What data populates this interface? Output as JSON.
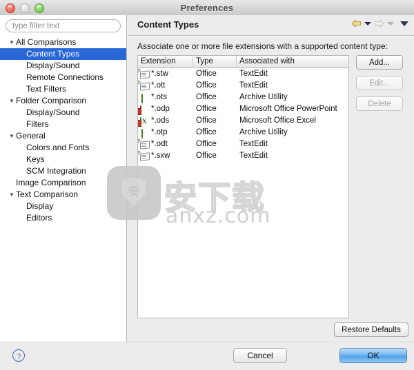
{
  "window": {
    "title": "Preferences",
    "traffic_lights": [
      "close-button",
      "minimize-button",
      "zoom-button"
    ]
  },
  "sidebar": {
    "filter": {
      "placeholder": "type filter text",
      "value": ""
    },
    "items": [
      {
        "label": "All Comparisons",
        "level": 0,
        "expander": "▼",
        "selected": false
      },
      {
        "label": "Content Types",
        "level": 1,
        "expander": "",
        "selected": true
      },
      {
        "label": "Display/Sound",
        "level": 1,
        "expander": "",
        "selected": false
      },
      {
        "label": "Remote Connections",
        "level": 1,
        "expander": "",
        "selected": false
      },
      {
        "label": "Text Filters",
        "level": 1,
        "expander": "",
        "selected": false
      },
      {
        "label": "Folder Comparison",
        "level": 0,
        "expander": "▼",
        "selected": false
      },
      {
        "label": "Display/Sound",
        "level": 1,
        "expander": "",
        "selected": false
      },
      {
        "label": "Filters",
        "level": 1,
        "expander": "",
        "selected": false
      },
      {
        "label": "General",
        "level": 0,
        "expander": "▼",
        "selected": false
      },
      {
        "label": "Colors and Fonts",
        "level": 1,
        "expander": "",
        "selected": false
      },
      {
        "label": "Keys",
        "level": 1,
        "expander": "",
        "selected": false
      },
      {
        "label": "SCM Integration",
        "level": 1,
        "expander": "",
        "selected": false
      },
      {
        "label": "Image Comparison",
        "level": 0,
        "expander": "",
        "selected": false
      },
      {
        "label": "Text Comparison",
        "level": 0,
        "expander": "▼",
        "selected": false
      },
      {
        "label": "Display",
        "level": 1,
        "expander": "",
        "selected": false
      },
      {
        "label": "Editors",
        "level": 1,
        "expander": "",
        "selected": false
      }
    ]
  },
  "content": {
    "title": "Content Types",
    "description": "Associate one or more file extensions with a supported content type:",
    "nav": {
      "back_icon": "back-arrow-icon",
      "back_enabled": true,
      "forward_icon": "forward-arrow-icon",
      "forward_enabled": false,
      "menu_icon": "chevron-down-icon"
    },
    "table": {
      "columns": [
        "Extension",
        "Type",
        "Associated with"
      ],
      "rows": [
        {
          "icon": "document-edit-icon",
          "extension": "*.stw",
          "type": "Office",
          "associated_with": "TextEdit"
        },
        {
          "icon": "document-edit-icon",
          "extension": "*.ott",
          "type": "Office",
          "associated_with": "TextEdit"
        },
        {
          "icon": "archive-icon",
          "extension": "*.ots",
          "type": "Office",
          "associated_with": "Archive Utility"
        },
        {
          "icon": "powerpoint-icon",
          "extension": "*.odp",
          "type": "Office",
          "associated_with": "Microsoft Office PowerPoint"
        },
        {
          "icon": "excel-icon",
          "extension": "*.ods",
          "type": "Office",
          "associated_with": "Microsoft Office Excel"
        },
        {
          "icon": "archive-icon",
          "extension": "*.otp",
          "type": "Office",
          "associated_with": "Archive Utility"
        },
        {
          "icon": "document-edit-icon",
          "extension": "*.odt",
          "type": "Office",
          "associated_with": "TextEdit"
        },
        {
          "icon": "document-edit-icon",
          "extension": "*.sxw",
          "type": "Office",
          "associated_with": "TextEdit"
        }
      ]
    },
    "buttons": {
      "add": {
        "label": "Add...",
        "enabled": true
      },
      "edit": {
        "label": "Edit...",
        "enabled": false
      },
      "delete": {
        "label": "Delete",
        "enabled": false
      }
    },
    "restore_defaults": "Restore Defaults"
  },
  "footer": {
    "help_icon": "help-question-icon",
    "cancel": "Cancel",
    "ok": "OK"
  },
  "watermark": {
    "glyph": "安",
    "brand": "安下载",
    "site": "anxz.com"
  },
  "colors": {
    "selection_blue": "#2767d6",
    "ok_blue": "#4e9fe8",
    "back_arrow_gold": "#e8c35a",
    "forward_arrow_gray": "#c9c9c9",
    "help_blue": "#4a63b5"
  }
}
